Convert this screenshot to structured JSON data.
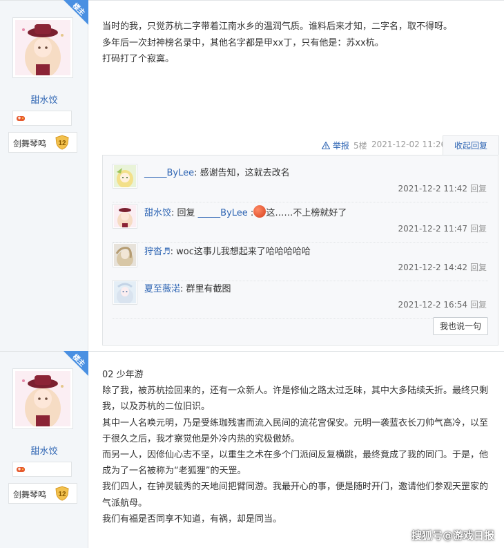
{
  "post1": {
    "badge": "楼主",
    "username": "甜水饺",
    "level_name": "剑舞琴鸣",
    "level_num": "12",
    "lines": [
      "当时的我，只觉苏杭二字带着江南水乡的温润气质。谁料后来才知，二字名，取不得呀。",
      "多年后一次封神榜名录中，其他名字都是甲xx丁，只有他是：苏xx杭。",
      "打码打了个寂寞。"
    ],
    "meta": {
      "report": "举报",
      "floor": "5楼",
      "time": "2021-12-02 11:26",
      "fold": "收起回复"
    },
    "replies": [
      {
        "user": "_____ByLee",
        "sep": ": ",
        "text": "感谢告知，这就去改名",
        "time": "2021-12-2 11:42",
        "reply": "回复"
      },
      {
        "user": "甜水饺",
        "sep": ": ",
        "text_pre": "回复 ",
        "mention": "_____ByLee",
        "text_mid": " :",
        "text_post": "这……不上榜就好了",
        "time": "2021-12-2 11:47",
        "reply": "回复"
      },
      {
        "user": "狩沓♬",
        "sep": ": ",
        "text": "woc这事儿我想起来了哈哈哈哈哈",
        "time": "2021-12-2 14:42",
        "reply": "回复"
      },
      {
        "user": "夏至薇渃",
        "sep": ": ",
        "text": "群里有截图",
        "time": "2021-12-2 16:54",
        "reply": "回复"
      }
    ],
    "say_button": "我也说一句"
  },
  "post2": {
    "badge": "楼主",
    "username": "甜水饺",
    "level_name": "剑舞琴鸣",
    "level_num": "12",
    "lines": [
      "02 少年游",
      "除了我，被苏杭捡回来的，还有一众新人。许是修仙之路太过乏味，其中大多陆续夭折。最终只剩我，以及苏杭的二位旧识。",
      "其中一人名唤元明，乃是受练珈残害而流入民间的流花宫保安。元明一袭蓝衣长刀帅气高冷，以至于很久之后，我才察觉他是外冷内热的究极傲娇。",
      "而另一人，因修仙心志不坚，以重生之术在多个门派间反复横跳，最终竟成了我的同门。于是，他成为了一名被称为“老狐狸”的天罡。",
      "我们四人，在钟灵毓秀的天地间把臂同游。我最开心的事，便是随时开门，邀请他们参观天罡家的气派航母。",
      "我们有福是否同享不知道，有祸，却是同当。"
    ]
  },
  "watermark": "搜狐号@游戏日报",
  "colors": {
    "link": "#2d64b3",
    "badge": "#4a90e2",
    "sidebar": "#f3f6f9"
  }
}
